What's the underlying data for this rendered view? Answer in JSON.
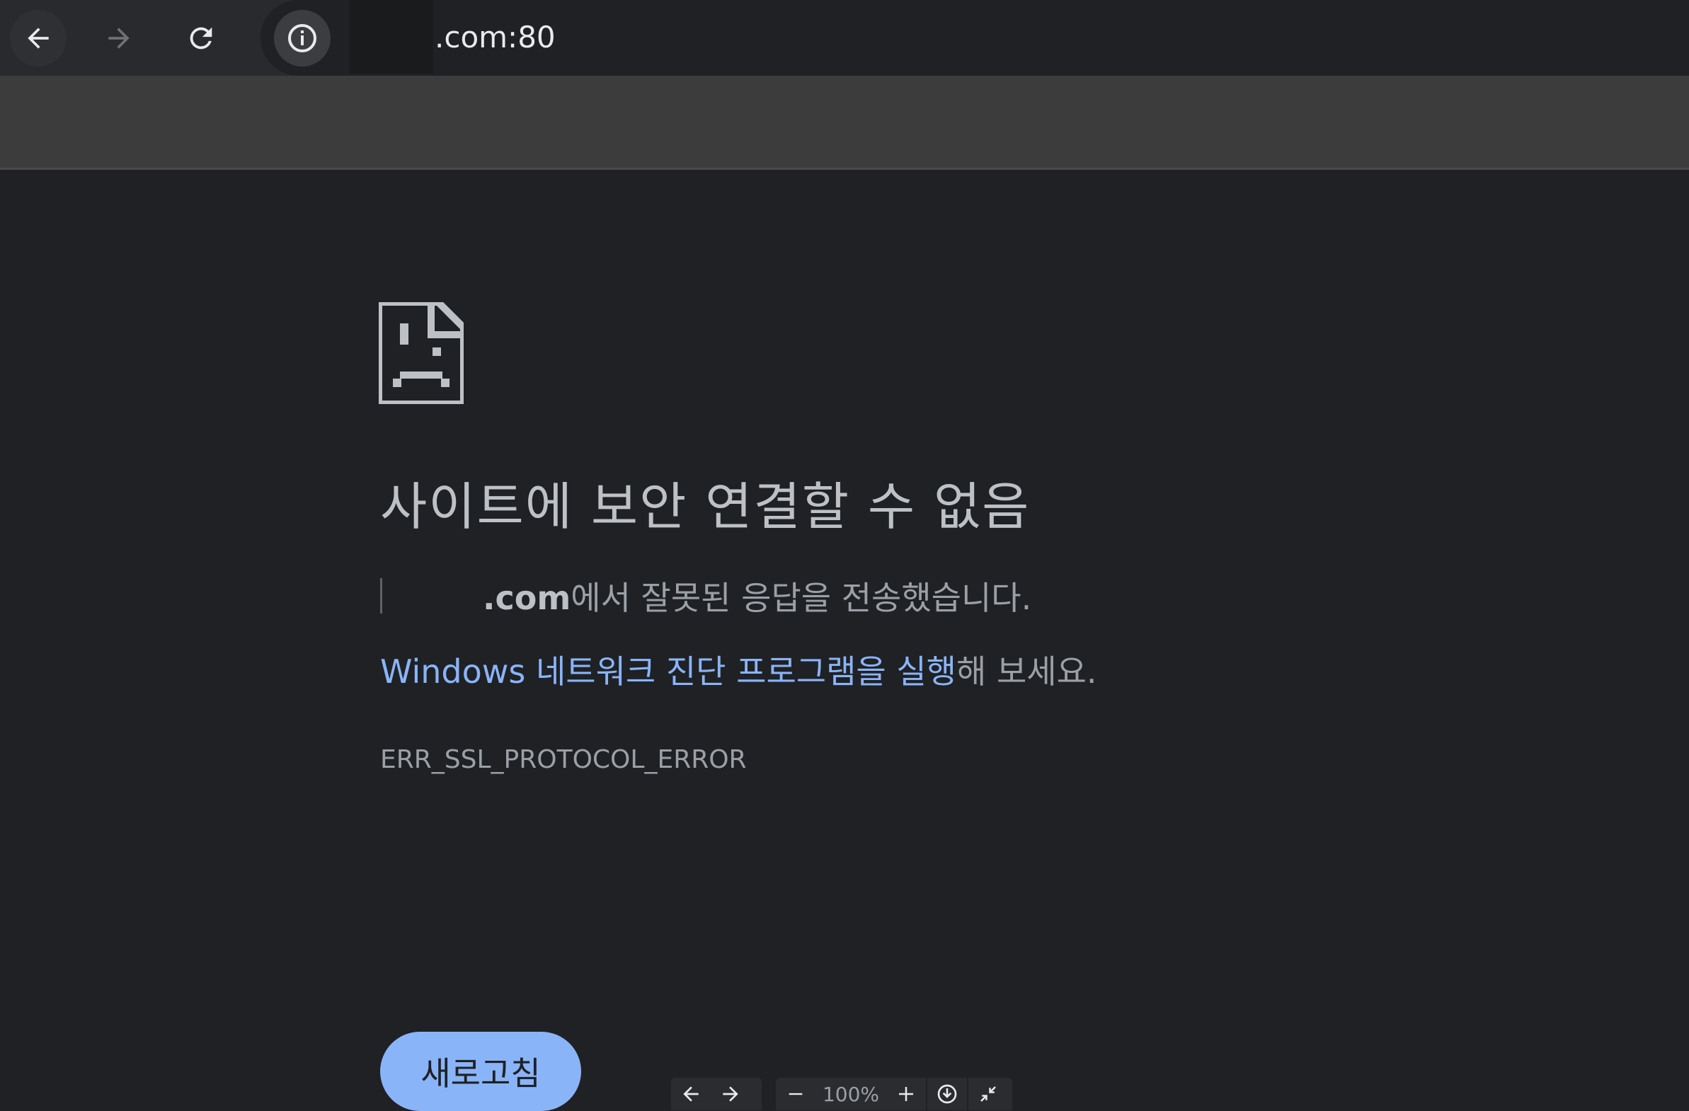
{
  "browser": {
    "url_visible": ".com:80",
    "icons": {
      "back": "back-arrow-icon",
      "forward": "forward-arrow-icon",
      "reload": "reload-icon",
      "site_info": "info-icon"
    }
  },
  "error_page": {
    "icon": "sad-document-icon",
    "title": "사이트에 보안 연결할 수 없음",
    "description_domain": ".com",
    "description_suffix": "에서 잘못된 응답을 전송했습니다.",
    "suggestion_link": "Windows 네트워크 진단 프로그램을 실행",
    "suggestion_suffix": "해 보세요.",
    "error_code": "ERR_SSL_PROTOCOL_ERROR",
    "reload_button": "새로고침"
  },
  "viewer_controls": {
    "zoom": "100%"
  },
  "colors": {
    "background": "#202124",
    "link": "#8ab4f8",
    "button": "#8ab4f8",
    "text": "#9aa0a6"
  }
}
